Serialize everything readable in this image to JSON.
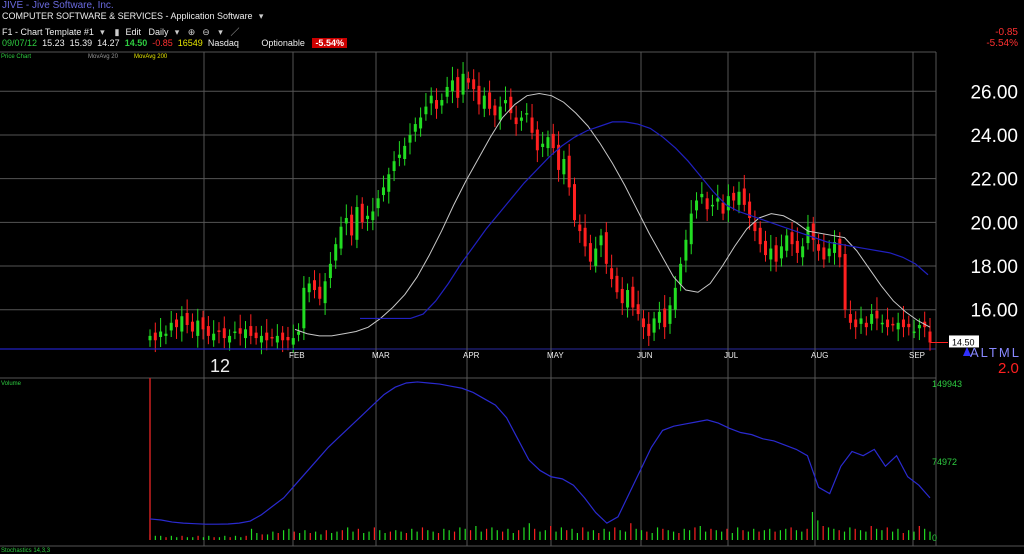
{
  "header": {
    "title": "JIVE - Jive Software, Inc.",
    "sector": "COMPUTER SOFTWARE & SERVICES - Application Software",
    "template": "F1 - Chart Template #1",
    "edit": "Edit",
    "period": "Daily",
    "date": "09/07/12",
    "open": "15.23",
    "high": "15.39",
    "low": "14.27",
    "close": "14.50",
    "change": "-0.85",
    "volume": "16549",
    "exchange": "Nasdaq",
    "optionable": "Optionable",
    "pct_change": "-5.54%"
  },
  "right_change": {
    "value": "-0.85",
    "pct": "-5.54%"
  },
  "legend": {
    "price": "Price Chart",
    "ma20": "MovAvg 20",
    "ma200": "MovAvg 200",
    "volume": "Volume",
    "bottom": "Stochastics 14,3,3"
  },
  "price_label": "14.50",
  "altml": "ALTML",
  "altml_val": "2.0",
  "colors": {
    "up": "#22dd22",
    "down": "#ff2020",
    "ma20": "#c8c8c8",
    "ma200": "#2020c0",
    "grid": "#555555"
  },
  "chart_data": [
    {
      "type": "candlestick",
      "title": "Price Chart",
      "yticks": [
        "26.00",
        "24.00",
        "22.00",
        "20.00",
        "18.00",
        "16.00"
      ],
      "ylim": [
        14.2,
        27.8
      ],
      "xticks": [
        "12",
        "FEB",
        "MAR",
        "APR",
        "MAY",
        "JUN",
        "JUL",
        "AUG",
        "SEP"
      ],
      "close_series": [
        14.8,
        14.6,
        15.0,
        14.9,
        15.4,
        15.2,
        15.7,
        15.3,
        15.0,
        15.5,
        15.1,
        14.8,
        14.9,
        15.0,
        14.7,
        14.8,
        15.0,
        14.9,
        15.1,
        14.8,
        14.7,
        14.8,
        14.6,
        14.7,
        14.8,
        14.6,
        14.6,
        14.7,
        15.0,
        17.0,
        17.2,
        16.9,
        16.5,
        17.3,
        18.1,
        19.0,
        19.8,
        20.2,
        19.4,
        20.7,
        20.0,
        20.3,
        20.5,
        21.1,
        21.6,
        22.2,
        22.8,
        23.1,
        23.5,
        24.0,
        24.5,
        24.8,
        25.3,
        25.8,
        25.2,
        25.6,
        26.2,
        26.5,
        25.7,
        26.8,
        26.4,
        26.1,
        25.4,
        25.8,
        25.2,
        24.9,
        25.3,
        25.6,
        25.0,
        24.5,
        24.8,
        25.0,
        24.1,
        23.3,
        23.6,
        23.9,
        23.4,
        22.4,
        22.9,
        21.6,
        20.1,
        19.6,
        18.9,
        18.2,
        18.8,
        19.4,
        18.1,
        17.4,
        16.8,
        16.3,
        16.9,
        16.1,
        15.8,
        15.2,
        14.8,
        15.6,
        15.9,
        15.2,
        16.2,
        17.0,
        18.1,
        19.2,
        20.4,
        21.0,
        21.3,
        20.6,
        20.8,
        21.1,
        20.4,
        21.2,
        21.0,
        21.4,
        20.8,
        20.2,
        19.6,
        19.0,
        18.5,
        18.8,
        18.2,
        18.9,
        19.4,
        19.0,
        18.6,
        18.9,
        19.8,
        19.2,
        18.7,
        18.3,
        18.8,
        19.1,
        18.4,
        16.0,
        15.4,
        15.2,
        15.6,
        15.2,
        15.8,
        15.6,
        15.4,
        15.2,
        15.3,
        15.4,
        15.2,
        15.2,
        15.0,
        15.3,
        15.2,
        14.5
      ],
      "ma20_start": [
        15.1,
        14.9,
        14.8,
        14.8,
        14.9,
        15.0,
        15.2,
        15.6,
        16.1,
        16.7,
        17.5,
        18.5,
        19.6,
        20.8,
        21.9,
        22.9,
        23.9,
        24.8,
        25.4,
        25.8,
        25.9,
        25.8,
        25.5,
        25.0,
        24.4,
        23.6,
        22.7,
        21.7,
        20.6,
        19.5,
        18.5,
        17.5,
        16.9,
        16.8,
        17.2,
        18.0,
        18.9,
        19.7,
        20.2,
        20.4,
        20.3,
        20.0,
        19.6,
        19.5,
        19.4,
        19.3,
        18.7,
        17.9,
        17.1,
        16.4,
        15.9,
        15.5,
        15.2
      ],
      "ma200": [
        15.6,
        15.6,
        15.6,
        15.6,
        15.6,
        15.8,
        16.4,
        17.2,
        18.1,
        18.9,
        19.7,
        20.4,
        21.1,
        21.8,
        22.4,
        23.0,
        23.5,
        23.9,
        24.2,
        24.4,
        24.6,
        24.6,
        24.5,
        24.3,
        23.9,
        23.4,
        22.8,
        22.1,
        21.4,
        20.8,
        20.5,
        20.3,
        20.1,
        19.9,
        19.7,
        19.5,
        19.3,
        19.1,
        19.0,
        18.9,
        18.8,
        18.7,
        18.6,
        18.4,
        18.1,
        17.6
      ],
      "last": 14.5
    },
    {
      "type": "bar+line",
      "title": "Volume",
      "yticks": [
        "149943",
        "74972",
        "0"
      ],
      "ylim": [
        0,
        149943
      ],
      "volume_avg_line": [
        20000,
        19000,
        17000,
        16000,
        15500,
        15000,
        15000,
        15200,
        16000,
        18000,
        24000,
        32000,
        40000,
        52000,
        64000,
        76000,
        88000,
        98000,
        108000,
        118000,
        128000,
        138000,
        145000,
        149000,
        150000,
        149000,
        148000,
        146000,
        144000,
        140000,
        134000,
        128000,
        116000,
        96000,
        76000,
        66000,
        60000,
        58000,
        52000,
        40000,
        26000,
        16000,
        22000,
        44000,
        66000,
        88000,
        104000,
        108000,
        110000,
        112000,
        114000,
        111000,
        106000,
        102000,
        100000,
        96000,
        94000,
        90000,
        86000,
        80000,
        50000,
        44000,
        70000,
        84000,
        80000,
        86000,
        70000,
        80000,
        60000,
        52000,
        40000
      ],
      "volume_bars": [
        4,
        3,
        3,
        2,
        3,
        2,
        3,
        2,
        2,
        3,
        2,
        3,
        2,
        2,
        3,
        2,
        3,
        2,
        3,
        8,
        5,
        4,
        4,
        6,
        5,
        7,
        8,
        6,
        5,
        7,
        5,
        6,
        4,
        7,
        5,
        6,
        7,
        9,
        6,
        8,
        5,
        6,
        9,
        7,
        5,
        6,
        7,
        6,
        5,
        8,
        6,
        9,
        7,
        6,
        5,
        8,
        7,
        6,
        9,
        8,
        7,
        10,
        6,
        8,
        9,
        7,
        6,
        8,
        5,
        7,
        9,
        12,
        8,
        6,
        7,
        10,
        6,
        9,
        7,
        8,
        5,
        9,
        6,
        7,
        5,
        8,
        6,
        9,
        7,
        6,
        12,
        8,
        7,
        6,
        5,
        9,
        8,
        7,
        6,
        5,
        8,
        7,
        9,
        10,
        6,
        8,
        7,
        6,
        8,
        5,
        9,
        7,
        6,
        8,
        6,
        7,
        8,
        6,
        7,
        8,
        9,
        7,
        6,
        8,
        20,
        14,
        10,
        9,
        8,
        7,
        6,
        9,
        8,
        7,
        6,
        10,
        8,
        7,
        9,
        6,
        8,
        5,
        7,
        6,
        10,
        8,
        6
      ]
    }
  ]
}
